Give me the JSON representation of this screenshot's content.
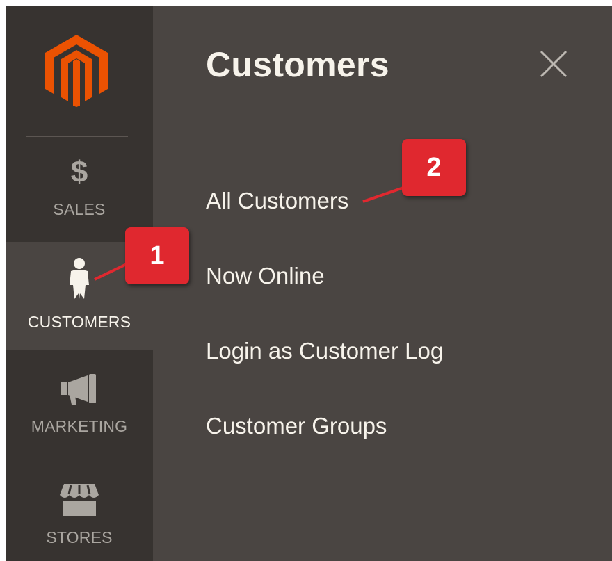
{
  "sidebar": {
    "logo": "magento-logo-icon",
    "items": [
      {
        "label": "SALES",
        "icon": "dollar-icon",
        "symbol": "$"
      },
      {
        "label": "CUSTOMERS",
        "icon": "customer-icon",
        "active": true
      },
      {
        "label": "MARKETING",
        "icon": "megaphone-icon"
      },
      {
        "label": "STORES",
        "icon": "store-icon"
      }
    ]
  },
  "panel": {
    "title": "Customers",
    "close_icon": "close-icon",
    "links": [
      {
        "label": "All Customers"
      },
      {
        "label": "Now Online"
      },
      {
        "label": "Login as Customer Log"
      },
      {
        "label": "Customer Groups"
      }
    ]
  },
  "annotations": {
    "step1": "1",
    "step2": "2"
  },
  "colors": {
    "sidebar_bg": "#373330",
    "panel_bg": "#4a4542",
    "logo_orange": "#eb5202",
    "badge_red": "#e0282f",
    "text_light": "#f7f3eb",
    "text_muted": "#aaa6a0"
  }
}
